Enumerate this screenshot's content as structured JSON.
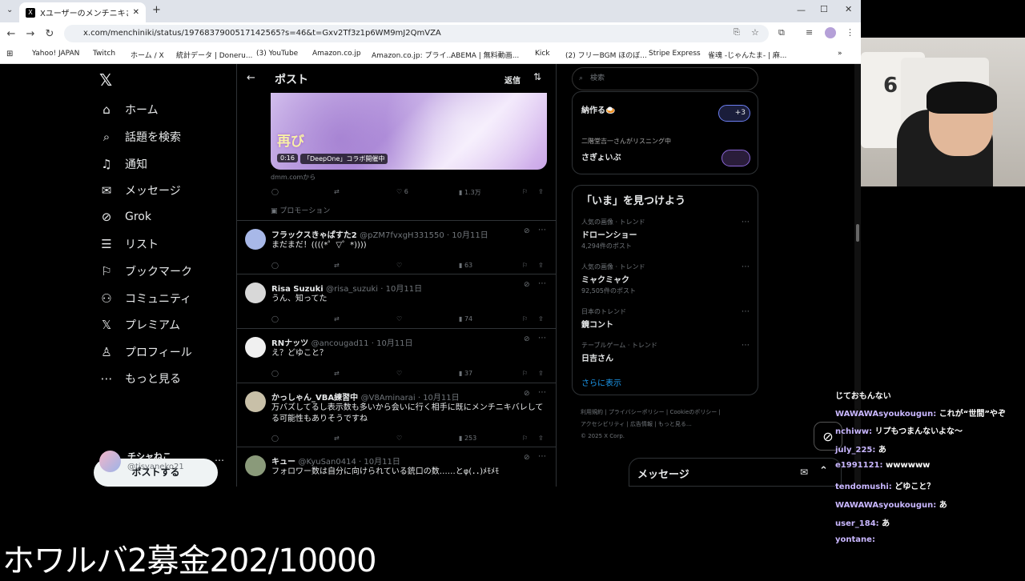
{
  "browser": {
    "tab_title": "Xユーザーのメンチニキさん:「まって割",
    "tab_close": "✕",
    "new_tab": "+",
    "url": "x.com/menchiniki/status/1976837900517142565?s=46&t=Gxv2Tf3z1p6WM9mJ2QmVZA",
    "bookmarks": [
      "Yahoo! JAPAN",
      "Twitch",
      "ホーム / X",
      "統計データ | Doneru...",
      "(3) YouTube",
      "Amazon.co.jp",
      "Amazon.co.jp: プライ...",
      "ABEMA | 無料動画...",
      "Kick",
      "(2) フリーBGM ほのぼ...",
      "Stripe Express",
      "雀魂 -じゃんたま- | 麻..."
    ]
  },
  "nav": {
    "items": [
      {
        "icon": "⌂",
        "label": "ホーム"
      },
      {
        "icon": "⌕",
        "label": "話題を検索"
      },
      {
        "icon": "♫",
        "label": "通知"
      },
      {
        "icon": "✉",
        "label": "メッセージ"
      },
      {
        "icon": "⊘",
        "label": "Grok"
      },
      {
        "icon": "☰",
        "label": "リスト"
      },
      {
        "icon": "⚐",
        "label": "ブックマーク"
      },
      {
        "icon": "⚇",
        "label": "コミュニティ"
      },
      {
        "icon": "𝕏",
        "label": "プレミアム"
      },
      {
        "icon": "♙",
        "label": "プロフィール"
      },
      {
        "icon": "⋯",
        "label": "もっと見る"
      }
    ],
    "post_button": "ポストする",
    "user_name": "チシャねこ",
    "user_handle": "@tisyaneko21"
  },
  "main": {
    "title": "ポスト",
    "reply_button": "返信",
    "promo": {
      "badge": "再び",
      "time": "0:16",
      "caption": "「DeepOne」コラボ開催中",
      "source": "dmm.comから",
      "likes": "6",
      "views": "1.3万",
      "promotion_label": "プロモーション"
    },
    "replies": [
      {
        "name": "フラックスきゃぱすた2",
        "handle": "@pZM7fvxgH331550",
        "date": "10月11日",
        "text": "まだまだ！((((*゜▽゜*))))",
        "views": "63",
        "avatar_color": "#a8b8e8"
      },
      {
        "name": "Risa Suzuki",
        "handle": "@risa_suzuki",
        "date": "10月11日",
        "text": "うん、知ってた",
        "views": "74",
        "avatar_color": "#d8d8d8"
      },
      {
        "name": "RNナッツ",
        "handle": "@ancougad11",
        "date": "10月11日",
        "text": "え？どゆこと？",
        "views": "37",
        "avatar_color": "#f0f0f0"
      },
      {
        "name": "かっしゃん_VBA練習中",
        "handle": "@V8Aminarai",
        "date": "10月11日",
        "text": "万バズしてるし表示数も多いから会いに行く相手に既にメンチニキバレしてる可能性もありそうですね",
        "views": "253",
        "avatar_color": "#c8c0a8"
      },
      {
        "name": "キュー",
        "handle": "@KyuSan0414",
        "date": "10月11日",
        "text": "フォロワー数は自分に向けられている銃口の数……とφ(．．)ﾒﾓﾒﾓ",
        "views": "",
        "avatar_color": "#8a9a7a"
      }
    ]
  },
  "right": {
    "search_placeholder": "検索",
    "spaces": [
      {
        "title": "納作る🍛",
        "count": "+3"
      },
      {
        "listener": "二階堂吉一さんがリスニング中",
        "title": "さぎょいぶ"
      }
    ],
    "discover_title": "「いま」を見つけよう",
    "trends": [
      {
        "category": "人気の画像 · トレンド",
        "name": "ドローンショー",
        "count": "4,294件のポスト"
      },
      {
        "category": "人気の画像 · トレンド",
        "name": "ミャクミャク",
        "count": "92,505件のポスト"
      },
      {
        "category": "日本のトレンド",
        "name": "鏡コント",
        "count": ""
      },
      {
        "category": "テーブルゲーム · トレンド",
        "name": "日吉さん",
        "count": ""
      }
    ],
    "show_more": "さらに表示",
    "footer": [
      "利用規約",
      "プライバシーポリシー",
      "Cookieのポリシー",
      "アクセシビリティ",
      "広告情報",
      "もっと見る…",
      "© 2025 X Corp."
    ],
    "messages_label": "メッセージ"
  },
  "chat": [
    {
      "name": "",
      "text": "じておもんない"
    },
    {
      "name": "WAWAWAsyoukougun:",
      "text": "これが“世間”やぞ"
    },
    {
      "name": "nchiww:",
      "text": "リプもつまんないよな〜"
    },
    {
      "name": "july_225:",
      "text": "あ"
    },
    {
      "name": "e1991121:",
      "text": "wwwwww"
    },
    {
      "name": "tendomushi:",
      "text": "どゆこと？"
    },
    {
      "name": "WAWAWAsyoukougun:",
      "text": "あ"
    },
    {
      "name": "user_184:",
      "text": "あ"
    },
    {
      "name": "yontane:",
      "text": ""
    }
  ],
  "overlay_caption": "ホワルバ2募金202/10000",
  "colors": {
    "x_bg": "#000000",
    "x_text": "#e7e9ea",
    "x_muted": "#71767b",
    "border": "#2f3336",
    "chat_name": "#c9b7ff"
  }
}
